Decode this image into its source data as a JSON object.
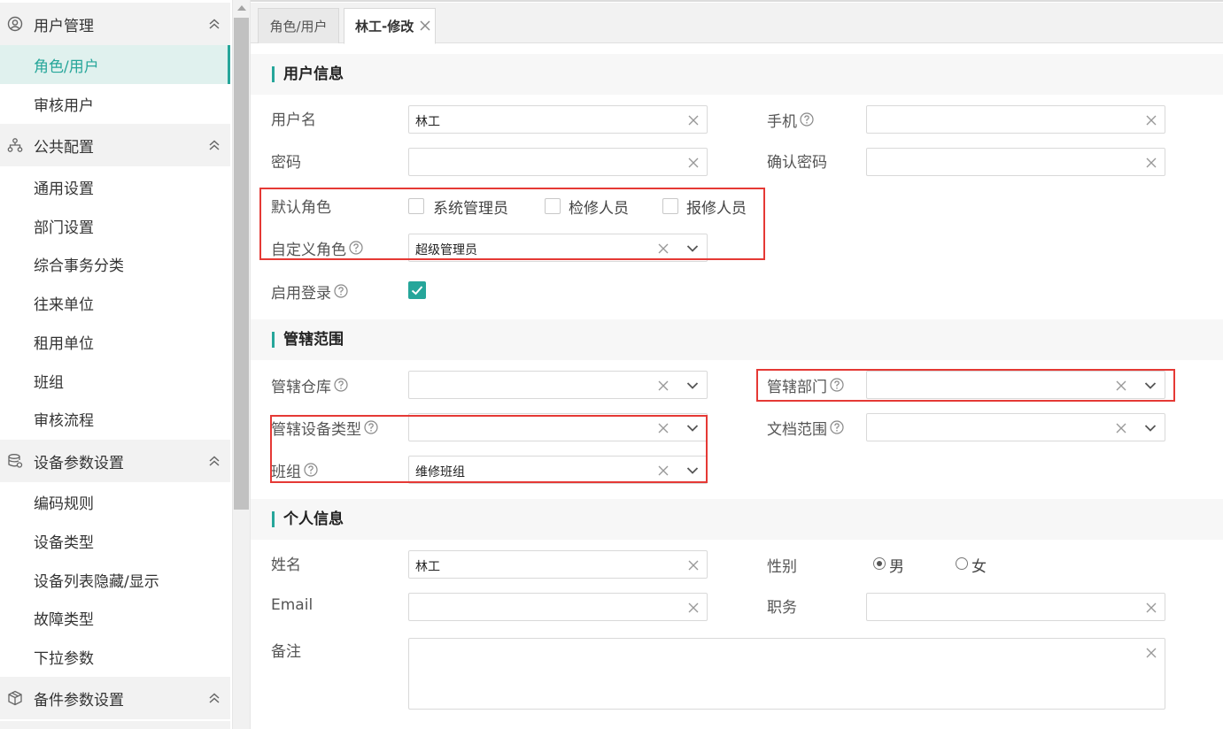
{
  "sidebar": {
    "groups": [
      {
        "label": "用户管理",
        "icon": "user-circle-icon",
        "items": [
          "角色/用户",
          "审核用户"
        ]
      },
      {
        "label": "公共配置",
        "icon": "org-chart-icon",
        "items": [
          "通用设置",
          "部门设置",
          "综合事务分类",
          "往来单位",
          "租用单位",
          "班组",
          "审核流程"
        ]
      },
      {
        "label": "设备参数设置",
        "icon": "database-gear-icon",
        "items": [
          "编码规则",
          "设备类型",
          "设备列表隐藏/显示",
          "故障类型",
          "下拉参数"
        ]
      },
      {
        "label": "备件参数设置",
        "icon": "box-icon",
        "items": []
      }
    ],
    "active_item": "角色/用户"
  },
  "tabs": [
    {
      "label": "角色/用户",
      "active": false
    },
    {
      "label": "林工-修改",
      "active": true
    }
  ],
  "sections": {
    "user_info": "用户信息",
    "scope": "管辖范围",
    "personal": "个人信息"
  },
  "form": {
    "username": {
      "label": "用户名",
      "value": "林工"
    },
    "phone": {
      "label": "手机",
      "value": ""
    },
    "password": {
      "label": "密码",
      "value": ""
    },
    "confirm_password": {
      "label": "确认密码",
      "value": ""
    },
    "default_role": {
      "label": "默认角色",
      "options": [
        {
          "label": "系统管理员",
          "checked": false
        },
        {
          "label": "检修人员",
          "checked": false
        },
        {
          "label": "报修人员",
          "checked": false
        }
      ]
    },
    "custom_role": {
      "label": "自定义角色",
      "value": "超级管理员"
    },
    "enable_login": {
      "label": "启用登录",
      "checked": true
    },
    "warehouse": {
      "label": "管辖仓库",
      "value": ""
    },
    "department": {
      "label": "管辖部门",
      "value": ""
    },
    "device_type": {
      "label": "管辖设备类型",
      "value": ""
    },
    "doc_scope": {
      "label": "文档范围",
      "value": ""
    },
    "team": {
      "label": "班组",
      "value": "维修班组"
    },
    "name": {
      "label": "姓名",
      "value": "林工"
    },
    "gender": {
      "label": "性别",
      "options": [
        {
          "label": "男",
          "selected": true
        },
        {
          "label": "女",
          "selected": false
        }
      ]
    },
    "email": {
      "label": "Email",
      "value": ""
    },
    "job": {
      "label": "职务",
      "value": ""
    },
    "remark": {
      "label": "备注",
      "value": ""
    }
  },
  "colors": {
    "accent": "#26a69a",
    "highlight": "#e53935"
  }
}
